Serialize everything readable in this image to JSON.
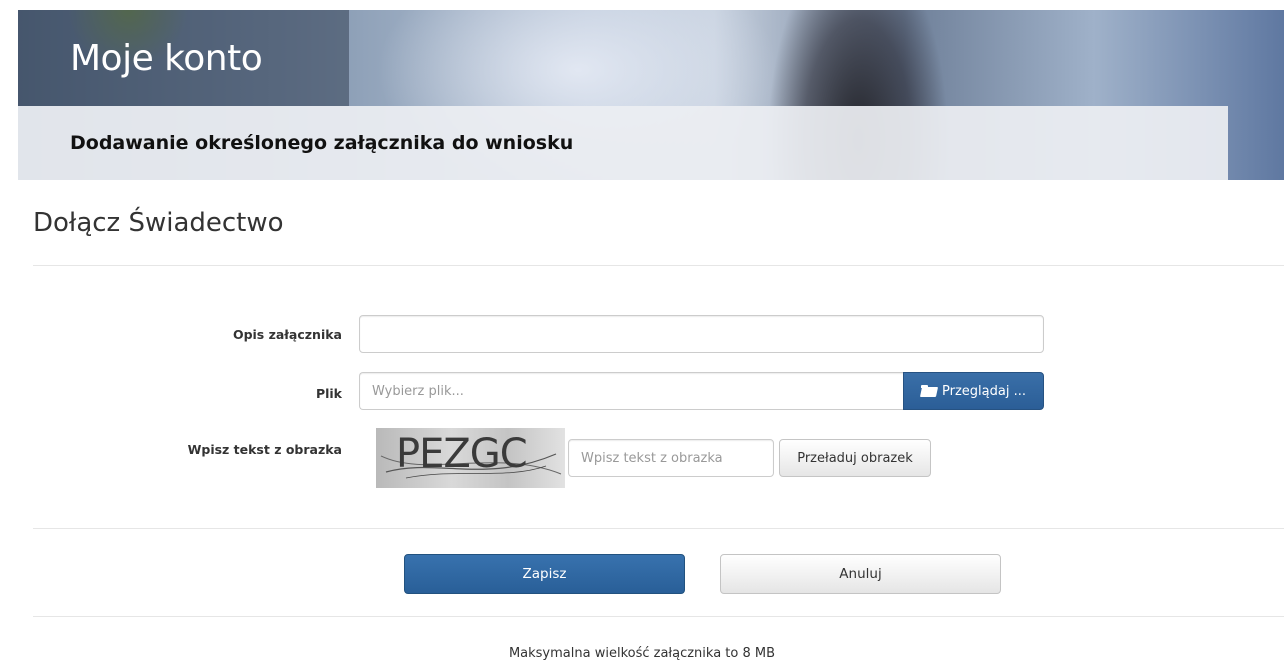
{
  "header": {
    "title": "Moje konto",
    "subtitle": "Dodawanie określonego załącznika do wniosku"
  },
  "page": {
    "heading": "Dołącz Świadectwo"
  },
  "form": {
    "description": {
      "label": "Opis załącznika",
      "value": "",
      "placeholder": ""
    },
    "file": {
      "label": "Plik",
      "placeholder": "Wybierz plik...",
      "browse_label": "Przeglądaj ...",
      "browse_icon": "folder-open-icon"
    },
    "captcha": {
      "label": "Wpisz tekst z obrazka",
      "image_text": "PEZGC",
      "placeholder": "Wpisz tekst z obrazka",
      "reload_label": "Przeładuj obrazek"
    }
  },
  "actions": {
    "save_label": "Zapisz",
    "cancel_label": "Anuluj"
  },
  "footer": {
    "note": "Maksymalna wielkość załącznika to 8 MB"
  },
  "colors": {
    "primary": "#2b5e97",
    "text": "#333333",
    "divider": "#e6e6e6"
  }
}
